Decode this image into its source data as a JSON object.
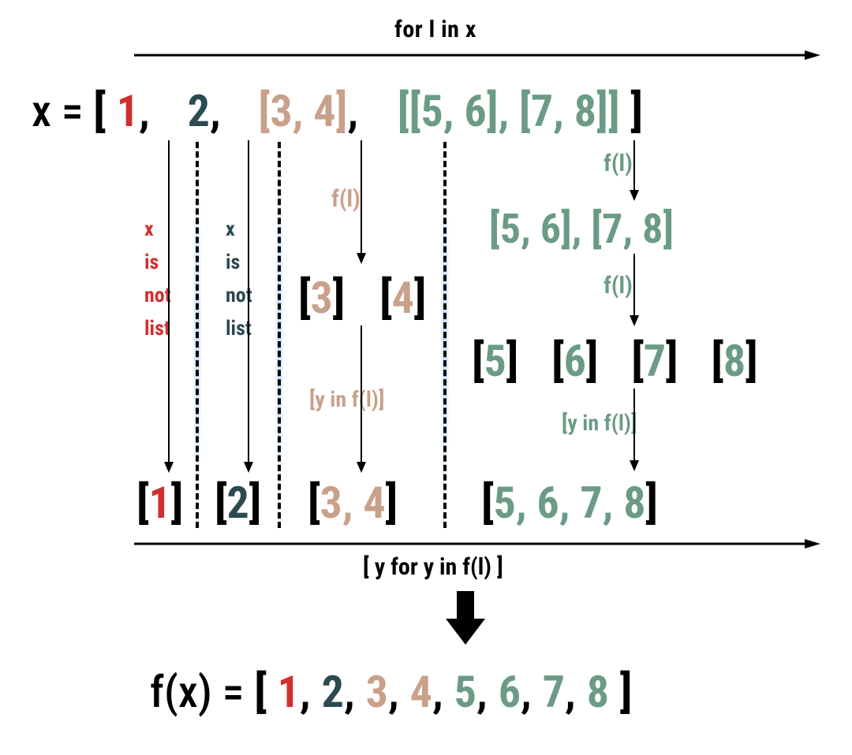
{
  "labels": {
    "for_loop": "for l in x",
    "x_equals": "x = ",
    "fl_tan": "f(l)",
    "fl_green_top": "f(l)",
    "fl_green_mid": "f(l)",
    "y_in_fl_tan": "[y in f(l)]",
    "y_in_fl_green": "[y in f(l)]",
    "y_for_y": "[ y for y in f(l) ]",
    "fx_equals": "f(x) = "
  },
  "x_not_list_red": [
    "x",
    "is",
    "not",
    "list"
  ],
  "x_not_list_teal": [
    "x",
    "is",
    "not",
    "list"
  ],
  "input": {
    "open": "[ ",
    "p1": "1",
    "c1": ", ",
    "p2": "2",
    "c2": ", ",
    "p3": "[3, 4]",
    "c3": ", ",
    "p4": "[[5, 6], [7, 8]]",
    "close": " ]"
  },
  "step_34": {
    "b3_open": "[",
    "b3_val": "3",
    "b3_close": "]",
    "b4_open": "[",
    "b4_val": "4",
    "b4_close": "]"
  },
  "step_5678_pairs": {
    "text": "[5, 6], [7, 8]"
  },
  "step_5678_singles": {
    "b5": "5",
    "b6": "6",
    "b7": "7",
    "b8": "8",
    "open": "[",
    "close": "]"
  },
  "row_results": {
    "r1": "1",
    "r2": "2",
    "r34": "3, 4",
    "r5678": "5, 6, 7, 8",
    "open": "[",
    "close": "]"
  },
  "output": {
    "open": "[ ",
    "v1": "1",
    "v2": "2",
    "v3": "3",
    "v4": "4",
    "v5": "5",
    "v6": "6",
    "v7": "7",
    "v8": "8",
    "close": " ]",
    "comma": ", "
  }
}
